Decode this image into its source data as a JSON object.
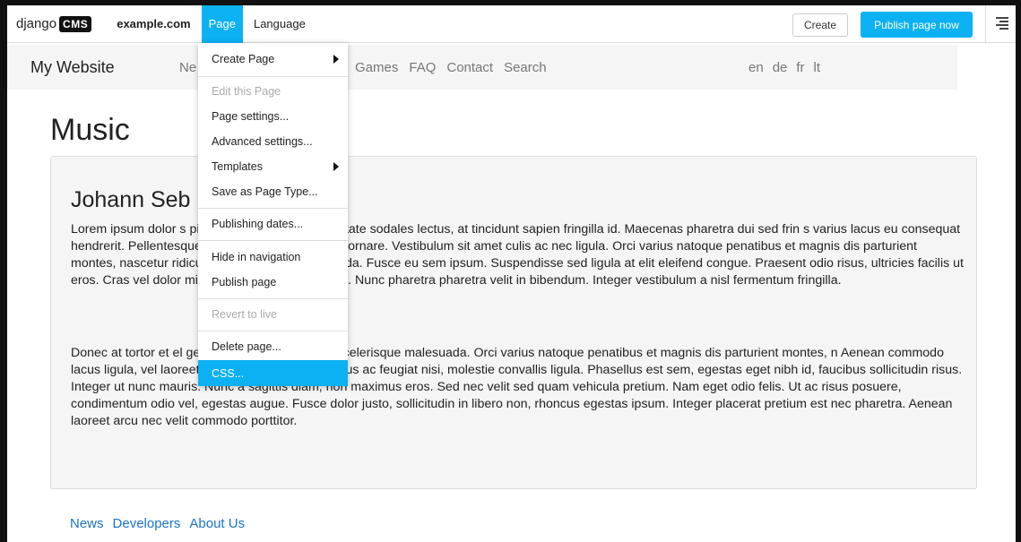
{
  "toolbar": {
    "logo_text": "django",
    "logo_badge": "CMS",
    "site": "example.com",
    "menu_page": "Page",
    "menu_language": "Language",
    "create_label": "Create",
    "publish_label": "Publish page now",
    "structure_icon": "structure-toggle-icon",
    "accent": "#0bb1f3"
  },
  "site_nav": {
    "brand": "My Website",
    "item_partial": "Ne",
    "items_right": [
      "Games",
      "FAQ",
      "Contact",
      "Search"
    ],
    "languages": [
      "en",
      "de",
      "fr",
      "lt"
    ]
  },
  "content": {
    "title": "Music",
    "heading": "Johann Seb",
    "paragraph1": "Lorem ipsum dolor s                                                 piscing elit. Phasellus vulputate sodales lectus, at tincidunt sapien fringilla id. Maecenas pharetra dui sed frin                                                    s varius lacus eu consequat hendrerit. Pellentesque vitae sem id justo aliquet ornare. Vestibulum sit amet                                                   culis ac nec ligula. Orci varius natoque penatibus et magnis dis parturient montes, nascetur ridiculus mus. Quisq                                                    s eu gravida. Fusce eu sem ipsum. Suspendisse sed ligula at elit eleifend congue. Praesent odio risus, ultricies facilis                                                    ut eros. Cras vel dolor mi. Maecenas vel auctor erat. Nunc pharetra pharetra velit in bibendum. Integer vestibulum a                                                    nisl fermentum fringilla.",
    "paragraph2": "Donec at tortor et el                                                 get at risus. Sed vulputate scelerisque malesuada. Orci varius natoque penatibus et magnis dis parturient montes, n                                                 Aenean commodo lacus ligula, vel laoreet diam tristique non. Vivamus ac feugiat nisi, molestie convallis ligula. Phasellus est sem, egestas eget nibh id, faucibus sollicitudin risus. Integer ut nunc mauris. Nunc a sagittis diam, non maximus eros. Sed nec velit sed quam vehicula pretium. Nam eget odio felis. Ut ac risus posuere, condimentum odio vel, egestas augue. Fusce dolor justo, sollicitudin in libero non, rhoncus egestas ipsum. Integer placerat pretium est nec pharetra. Aenean laoreet arcu nec velit commodo porttitor."
  },
  "footer": {
    "links": [
      "News",
      "Developers",
      "About Us"
    ]
  },
  "page_menu": {
    "create_page": "Create Page",
    "edit_this_page": "Edit this Page",
    "page_settings": "Page settings...",
    "advanced_settings": "Advanced settings...",
    "templates": "Templates",
    "save_as_page_type": "Save as Page Type...",
    "publishing_dates": "Publishing dates...",
    "hide_in_navigation": "Hide in navigation",
    "publish_page": "Publish page",
    "revert_to_live": "Revert to live",
    "delete_page": "Delete page...",
    "css": "CSS..."
  }
}
